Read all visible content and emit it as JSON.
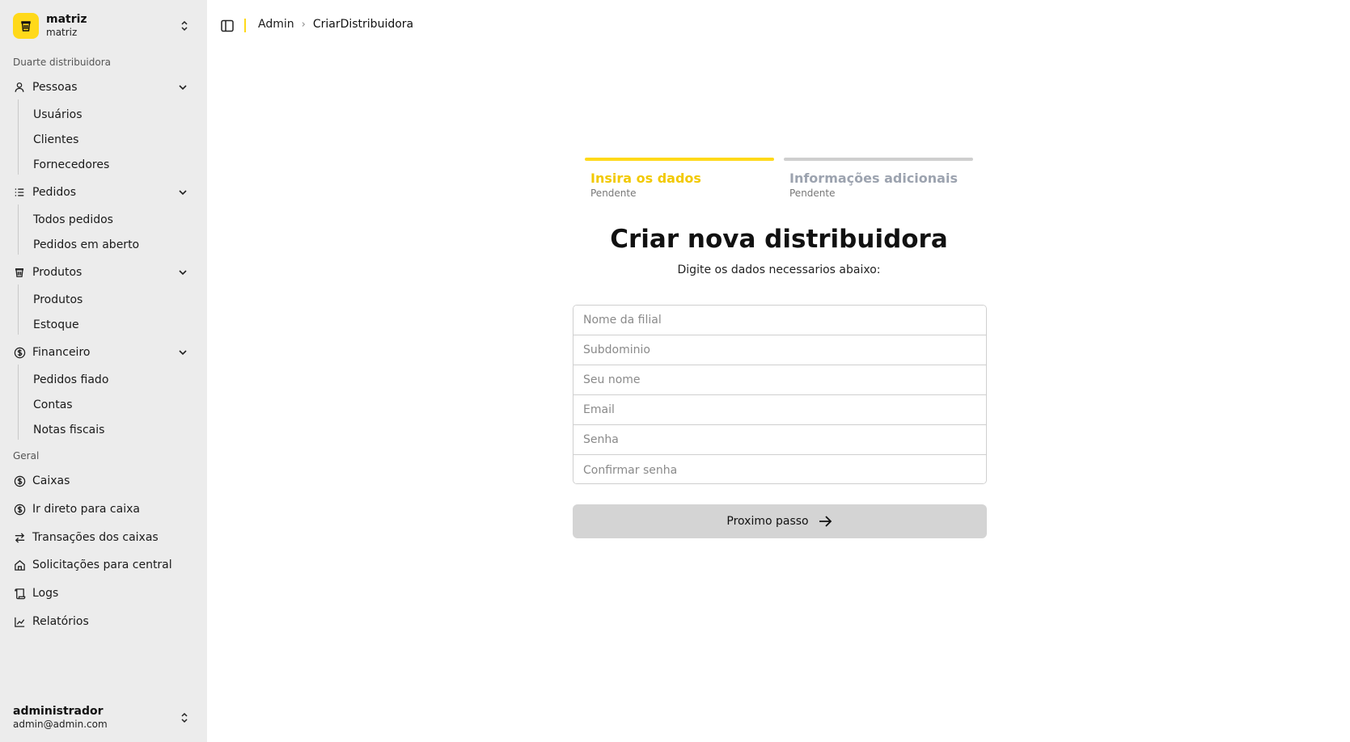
{
  "colors": {
    "accent": "#ffd91a",
    "sidebar_bg": "#ececec",
    "inactive_step": "#cfcfcf",
    "inactive_step_text": "#9ca3af",
    "button_bg": "#d4d4d4"
  },
  "org": {
    "name": "matriz",
    "subtitle": "matriz",
    "logo_icon": "cup-icon"
  },
  "sidebar": {
    "section_company": "Duarte distribuidora",
    "groups": [
      {
        "label": "Pessoas",
        "icon": "user-icon",
        "items": [
          "Usuários",
          "Clientes",
          "Fornecedores"
        ]
      },
      {
        "label": "Pedidos",
        "icon": "list-icon",
        "items": [
          "Todos pedidos",
          "Pedidos em aberto"
        ]
      },
      {
        "label": "Produtos",
        "icon": "cup-icon",
        "items": [
          "Produtos",
          "Estoque"
        ]
      },
      {
        "label": "Financeiro",
        "icon": "dollar-circle-icon",
        "items": [
          "Pedidos fiado",
          "Contas",
          "Notas fiscais"
        ]
      }
    ],
    "section_general": "Geral",
    "general_items": [
      {
        "label": "Caixas",
        "icon": "dollar-circle-icon"
      },
      {
        "label": "Ir direto para caixa",
        "icon": "dollar-circle-icon"
      },
      {
        "label": "Transações dos caixas",
        "icon": "arrows-left-right-icon"
      },
      {
        "label": "Solicitações para central",
        "icon": "home-icon"
      },
      {
        "label": "Logs",
        "icon": "scroll-icon"
      },
      {
        "label": "Relatórios",
        "icon": "chart-icon"
      }
    ]
  },
  "user": {
    "name": "administrador",
    "email": "admin@admin.com"
  },
  "breadcrumb": {
    "root": "Admin",
    "current": "CriarDistribuidora"
  },
  "steps": [
    {
      "title": "Insira os dados",
      "status": "Pendente",
      "active": true
    },
    {
      "title": "Informações adicionais",
      "status": "Pendente",
      "active": false
    }
  ],
  "form": {
    "title": "Criar nova distribuidora",
    "subtitle": "Digite os dados necessarios abaixo:",
    "fields": [
      {
        "placeholder": "Nome da filial",
        "value": ""
      },
      {
        "placeholder": "Subdominio",
        "value": ""
      },
      {
        "placeholder": "Seu nome",
        "value": ""
      },
      {
        "placeholder": "Email",
        "value": ""
      },
      {
        "placeholder": "Senha",
        "value": ""
      },
      {
        "placeholder": "Confirmar senha",
        "value": ""
      }
    ],
    "next_label": "Proximo passo"
  }
}
